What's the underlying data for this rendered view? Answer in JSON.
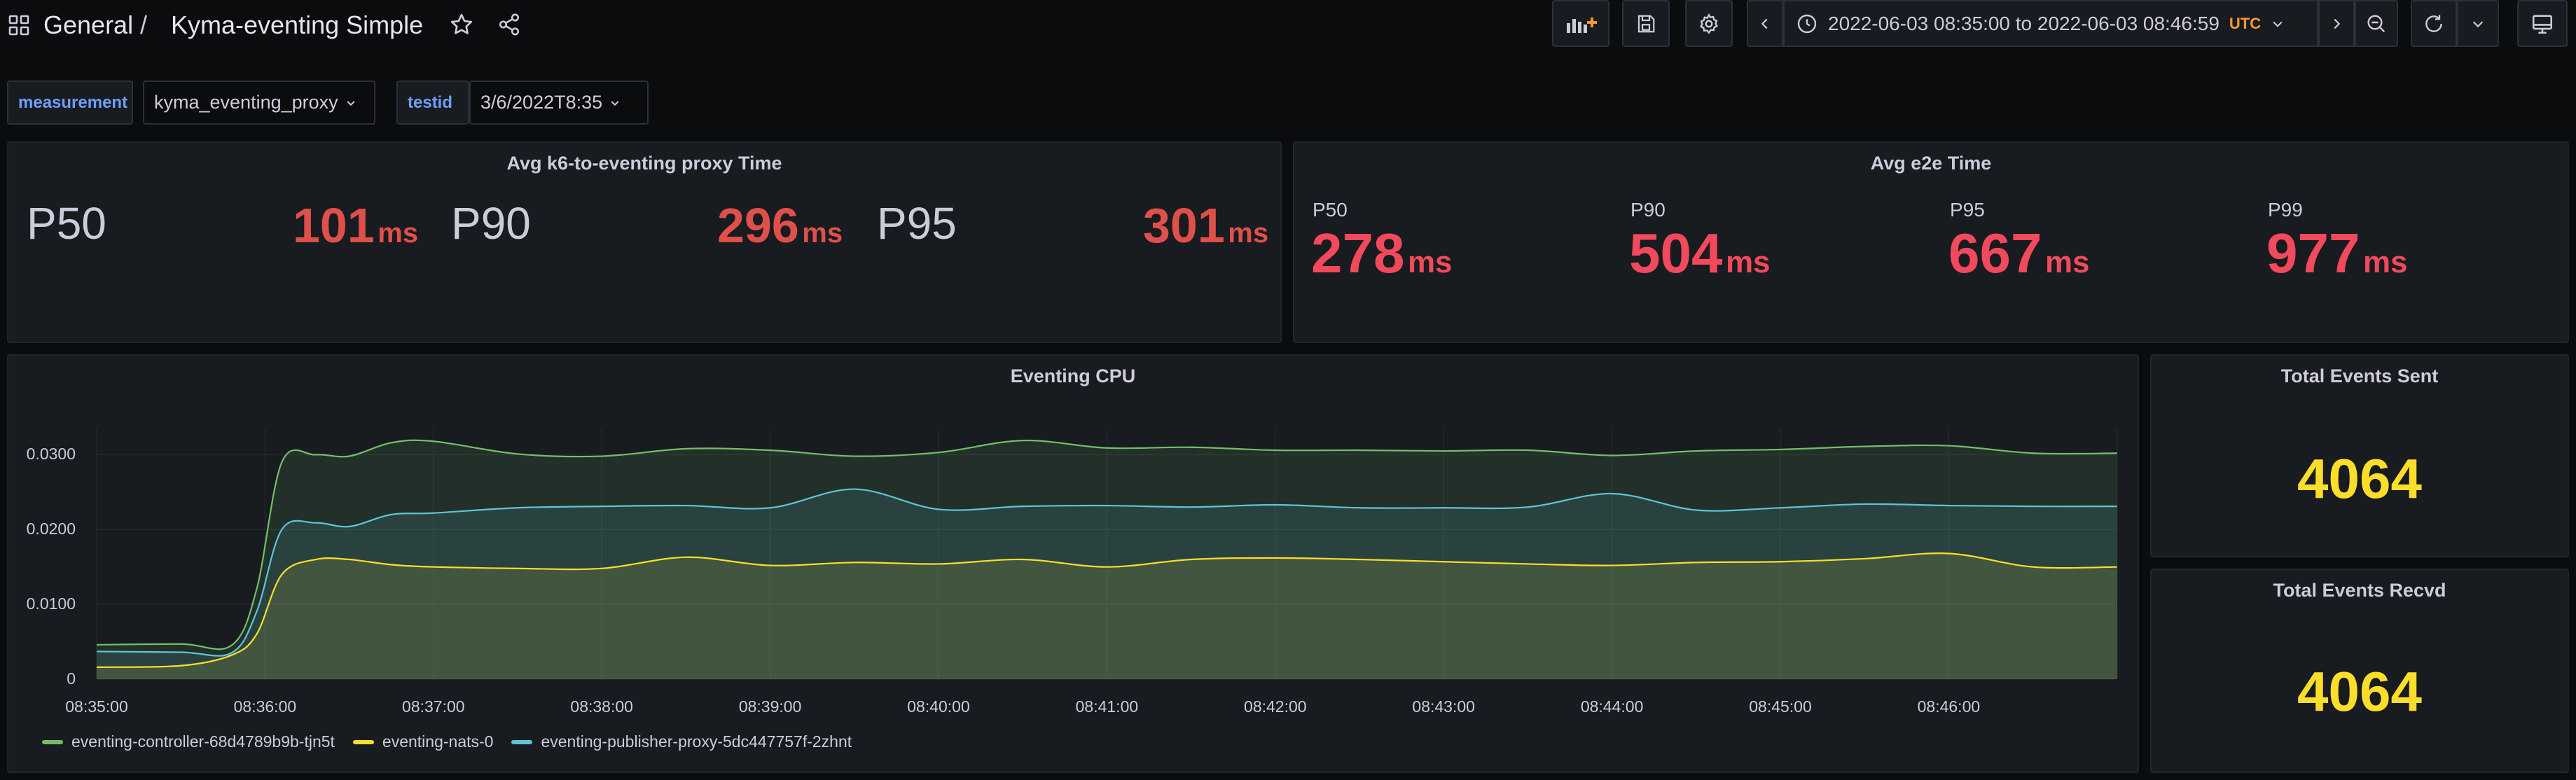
{
  "header": {
    "breadcrumb_folder": "General",
    "breadcrumb_sep": "/",
    "dashboard_title": "Kyma-eventing Simple",
    "time_range": "2022-06-03 08:35:00 to 2022-06-03 08:46:59",
    "timezone": "UTC"
  },
  "variables": [
    {
      "label": "measurement",
      "value": "kyma_eventing_proxy"
    },
    {
      "label": "testid",
      "value": "3/6/2022T8:35"
    }
  ],
  "panels": {
    "proxy": {
      "title": "Avg k6-to-eventing proxy Time",
      "stats": [
        {
          "label": "P50",
          "value": "101",
          "unit": "ms"
        },
        {
          "label": "P90",
          "value": "296",
          "unit": "ms"
        },
        {
          "label": "P95",
          "value": "301",
          "unit": "ms"
        }
      ]
    },
    "e2e": {
      "title": "Avg e2e Time",
      "stats": [
        {
          "label": "P50",
          "value": "278",
          "unit": "ms"
        },
        {
          "label": "P90",
          "value": "504",
          "unit": "ms"
        },
        {
          "label": "P95",
          "value": "667",
          "unit": "ms"
        },
        {
          "label": "P99",
          "value": "977",
          "unit": "ms"
        }
      ]
    },
    "events_sent": {
      "title": "Total Events Sent",
      "value": "4064"
    },
    "events_recvd": {
      "title": "Total Events Recvd",
      "value": "4064"
    }
  },
  "chart_data": {
    "type": "area",
    "title": "Eventing CPU",
    "x_ticks": [
      "08:35:00",
      "08:36:00",
      "08:37:00",
      "08:38:00",
      "08:39:00",
      "08:40:00",
      "08:41:00",
      "08:42:00",
      "08:43:00",
      "08:44:00",
      "08:45:00",
      "08:46:00"
    ],
    "y_ticks": [
      "0",
      "0.0100",
      "0.0200",
      "0.0300"
    ],
    "ylim": [
      0,
      0.0335
    ],
    "x_minutes_range": [
      0,
      12
    ],
    "x_minutes": [
      0,
      0.5,
      0.8,
      0.95,
      1.1,
      1.3,
      1.5,
      1.75,
      2,
      2.5,
      3,
      3.5,
      4,
      4.5,
      5,
      5.5,
      6,
      6.5,
      7,
      7.5,
      8,
      8.5,
      9,
      9.5,
      10,
      10.5,
      11,
      11.5,
      12
    ],
    "series": [
      {
        "name": "eventing-controller-68d4789b9b-tjn5t",
        "color": "#73bf69",
        "values": [
          0.0046,
          0.0047,
          0.0045,
          0.012,
          0.029,
          0.03,
          0.0298,
          0.0316,
          0.0318,
          0.0301,
          0.0298,
          0.0308,
          0.0306,
          0.0298,
          0.0303,
          0.0319,
          0.0309,
          0.031,
          0.0306,
          0.0306,
          0.0305,
          0.0306,
          0.0299,
          0.0305,
          0.0307,
          0.0311,
          0.0312,
          0.0302,
          0.0302
        ]
      },
      {
        "name": "eventing-nats-0",
        "color": "#fade2a",
        "values": [
          0.0016,
          0.0018,
          0.0032,
          0.006,
          0.014,
          0.016,
          0.016,
          0.0153,
          0.015,
          0.0148,
          0.0148,
          0.0163,
          0.0152,
          0.0156,
          0.0154,
          0.016,
          0.015,
          0.016,
          0.0162,
          0.016,
          0.0157,
          0.0154,
          0.0152,
          0.0156,
          0.0157,
          0.0161,
          0.0168,
          0.015,
          0.015
        ]
      },
      {
        "name": "eventing-publisher-proxy-5dc447757f-2zhnt",
        "color": "#5ec4d8",
        "values": [
          0.0037,
          0.0036,
          0.0035,
          0.009,
          0.02,
          0.0209,
          0.0204,
          0.022,
          0.0222,
          0.0229,
          0.0231,
          0.0232,
          0.0229,
          0.0254,
          0.0227,
          0.0231,
          0.0232,
          0.023,
          0.0233,
          0.0229,
          0.0229,
          0.023,
          0.0248,
          0.0226,
          0.0229,
          0.0234,
          0.0232,
          0.0231,
          0.0231
        ]
      }
    ],
    "legend_placement": "bottom-left",
    "grid": true
  }
}
